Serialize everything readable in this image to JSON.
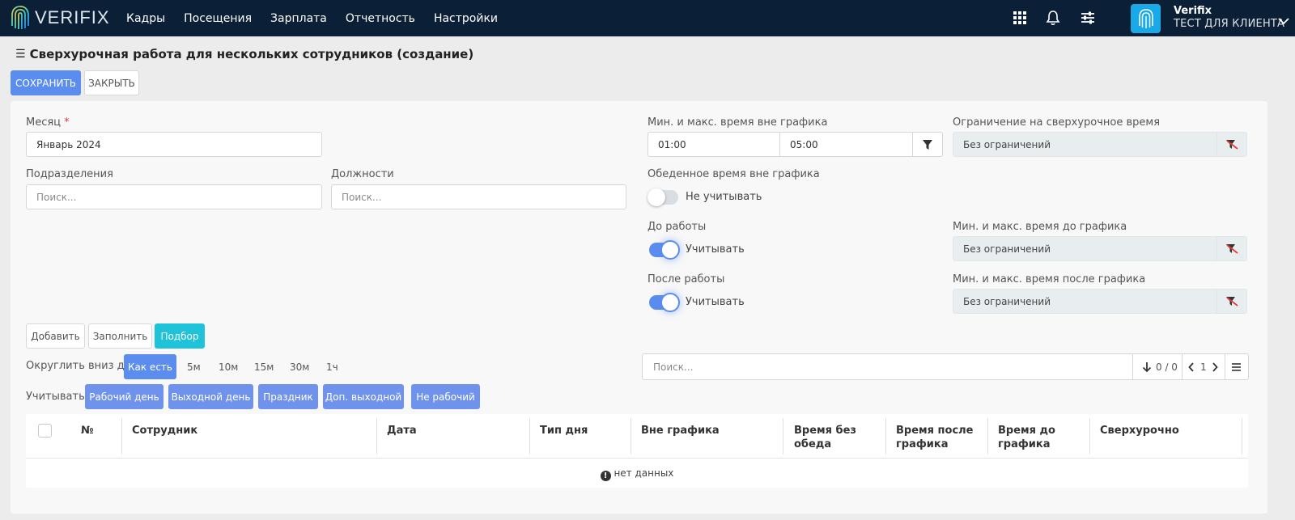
{
  "app": {
    "brand": "VERIFIX",
    "nav": [
      "Кадры",
      "Посещения",
      "Зарплата",
      "Отчетность",
      "Настройки"
    ],
    "user": {
      "name": "Verifix",
      "org": "ТЕСТ ДЛЯ КЛИЕНТА"
    }
  },
  "page": {
    "title": "Сверхурочная работа для нескольких сотрудников (создание)",
    "save_label": "СОХРАНИТЬ",
    "close_label": "ЗАКРЫТЬ"
  },
  "form": {
    "month_label": "Месяц",
    "month_required": "*",
    "month_value": "Январь 2024",
    "divisions_label": "Подразделения",
    "divisions_placeholder": "Поиск...",
    "positions_label": "Должности",
    "positions_placeholder": "Поиск...",
    "minmax_label": "Мин. и макс. время вне графика",
    "min_value": "01:00",
    "max_value": "05:00",
    "limit_label": "Ограничение на сверхурочное время",
    "limit_value": "Без ограничений",
    "lunch_label": "Обеденное время вне графика",
    "lunch_toggle_label": "Не учитывать",
    "lunch_on": false,
    "before_label": "До работы",
    "before_toggle_label": "Учитывать",
    "before_on": true,
    "before_minmax_label": "Мин. и макс. время до графика",
    "before_minmax_value": "Без ограничений",
    "after_label": "После работы",
    "after_toggle_label": "Учитывать",
    "after_on": true,
    "after_minmax_label": "Мин. и макс. время после графика",
    "after_minmax_value": "Без ограничений"
  },
  "actions": {
    "add": "Добавить",
    "fill": "Заполнить",
    "pick": "Подбор"
  },
  "rounding": {
    "label": "Округлить вниз до:",
    "options": [
      "Как есть",
      "5м",
      "10м",
      "15м",
      "30м",
      "1ч"
    ],
    "selected": "Как есть"
  },
  "consider": {
    "label": "Учитывать:",
    "options": [
      "Рабочий день",
      "Выходной день",
      "Праздник",
      "Доп. выходной",
      "Не рабочий"
    ]
  },
  "search": {
    "placeholder": "Поиск...",
    "count": "0 / 0",
    "page": "1"
  },
  "table": {
    "columns": [
      "№",
      "Сотрудник",
      "Дата",
      "Тип дня",
      "Вне графика",
      "Время без обеда",
      "Время после графика",
      "Время до графика",
      "Сверхурочно"
    ],
    "empty_text": "нет данных"
  },
  "colors": {
    "primary": "#5b8def",
    "cyan": "#1ec3d9",
    "topbar": "#0b1f36"
  }
}
